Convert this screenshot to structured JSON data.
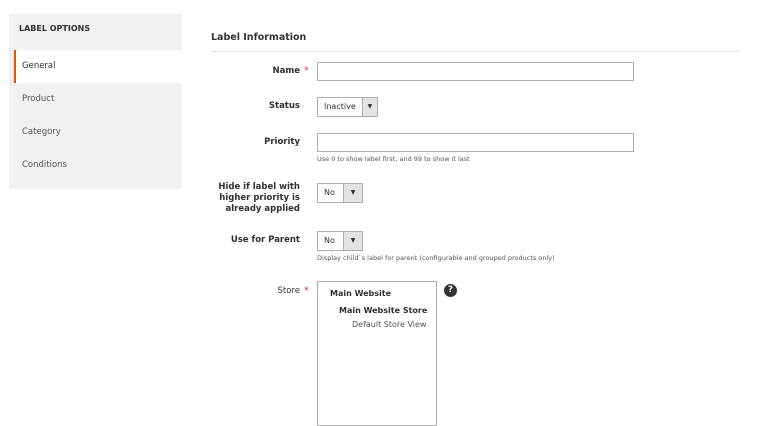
{
  "sidebar": {
    "heading": "LABEL OPTIONS",
    "items": [
      {
        "label": "General"
      },
      {
        "label": "Product"
      },
      {
        "label": "Category"
      },
      {
        "label": "Conditions"
      }
    ]
  },
  "section_title": "Label Information",
  "fields": {
    "name": {
      "label": "Name",
      "value": ""
    },
    "status": {
      "label": "Status",
      "value": "Inactive"
    },
    "priority": {
      "label": "Priority",
      "value": "",
      "note": "Use 0 to show label first, and 99 to show it last"
    },
    "hide": {
      "label_lines": [
        "Hide if label with",
        "higher priority is",
        "already applied"
      ],
      "value": "No"
    },
    "parent": {
      "label": "Use for Parent",
      "value": "No",
      "note": "Display child`s label for parent (configurable and grouped products only)"
    },
    "store": {
      "label": "Store",
      "options": [
        "Main Website",
        "Main Website Store",
        "Default Store View"
      ]
    }
  },
  "required_mark": "*",
  "help_glyph": "?"
}
